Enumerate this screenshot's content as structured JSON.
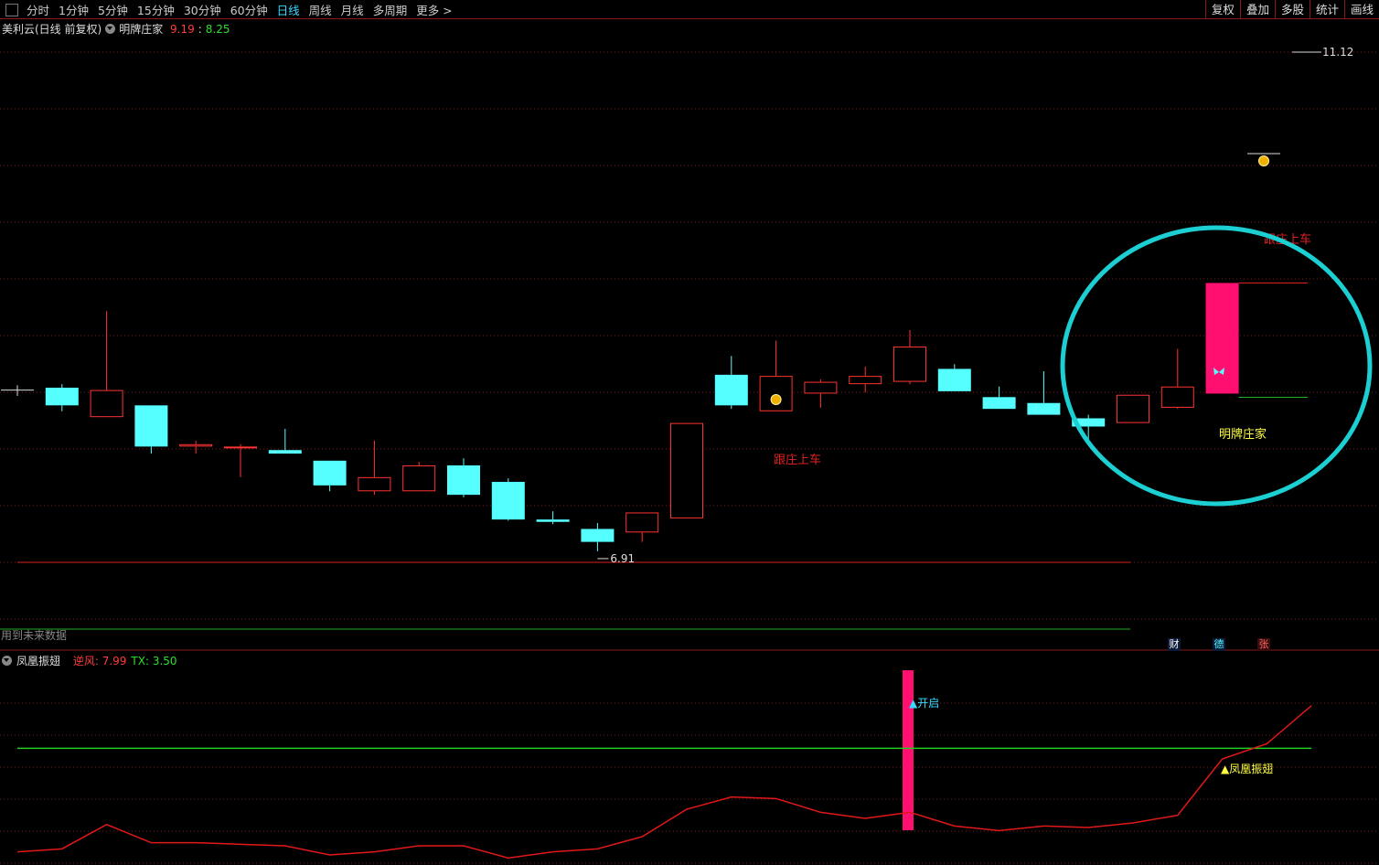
{
  "toolbar": {
    "periods": [
      "分时",
      "1分钟",
      "5分钟",
      "15分钟",
      "30分钟",
      "60分钟",
      "日线",
      "周线",
      "月线",
      "多周期",
      "更多 >"
    ],
    "active_period": "日线",
    "right_buttons": [
      "复权",
      "叠加",
      "多股",
      "统计",
      "画线"
    ]
  },
  "main_header": {
    "stock": "美利云(日线 前复权)",
    "indicator": "明牌庄家",
    "value1": "9.19",
    "value2": "8.25"
  },
  "main_labels": {
    "max_price": "11.12",
    "min_price": "6.91",
    "signal_text_1": "跟庄上车",
    "signal_text_2": "跟庄上车",
    "banker_text": "明牌庄家",
    "future_notice": "用到未来数据"
  },
  "badges": [
    "财",
    "德",
    "张"
  ],
  "sub_header": {
    "indicator": "凤凰振翅",
    "line1_label": "逆风: 7.99",
    "line2_label": "TX: 3.50"
  },
  "sub_labels": {
    "open_signal": "▲开启",
    "phoenix_signal": "▲凤凰振翅"
  },
  "colors": {
    "up": "#ff3333",
    "down": "#55ffff",
    "highlight_bar": "#ff0f70",
    "circle": "#1ccfd3",
    "threshold": "#20d020"
  },
  "chart_data": [
    {
      "type": "candlestick",
      "candles": [
        {
          "o": 8.28,
          "h": 8.32,
          "l": 8.23,
          "c": 8.28
        },
        {
          "o": 8.3,
          "h": 8.33,
          "l": 8.1,
          "c": 8.15
        },
        {
          "o": 8.05,
          "h": 8.95,
          "l": 8.05,
          "c": 8.28
        },
        {
          "o": 8.15,
          "h": 8.15,
          "l": 7.74,
          "c": 7.8
        },
        {
          "o": 7.8,
          "h": 7.85,
          "l": 7.74,
          "c": 7.82
        },
        {
          "o": 7.8,
          "h": 7.82,
          "l": 7.54,
          "c": 7.8
        },
        {
          "o": 7.77,
          "h": 7.95,
          "l": 7.74,
          "c": 7.74
        },
        {
          "o": 7.68,
          "h": 7.68,
          "l": 7.42,
          "c": 7.47
        },
        {
          "o": 7.42,
          "h": 7.85,
          "l": 7.39,
          "c": 7.54
        },
        {
          "o": 7.42,
          "h": 7.67,
          "l": 7.42,
          "c": 7.64
        },
        {
          "o": 7.64,
          "h": 7.7,
          "l": 7.37,
          "c": 7.39
        },
        {
          "o": 7.5,
          "h": 7.53,
          "l": 7.17,
          "c": 7.18
        },
        {
          "o": 7.18,
          "h": 7.25,
          "l": 7.14,
          "c": 7.16
        },
        {
          "o": 7.1,
          "h": 7.15,
          "l": 6.91,
          "c": 6.99
        },
        {
          "o": 7.07,
          "h": 7.24,
          "l": 6.99,
          "c": 7.24
        },
        {
          "o": 7.19,
          "h": 8.0,
          "l": 7.19,
          "c": 8.0
        },
        {
          "o": 8.41,
          "h": 8.57,
          "l": 8.12,
          "c": 8.15
        },
        {
          "o": 8.1,
          "h": 8.7,
          "l": 8.1,
          "c": 8.4
        },
        {
          "o": 8.25,
          "h": 8.37,
          "l": 8.13,
          "c": 8.35
        },
        {
          "o": 8.33,
          "h": 8.48,
          "l": 8.26,
          "c": 8.4
        },
        {
          "o": 8.35,
          "h": 8.79,
          "l": 8.33,
          "c": 8.65
        },
        {
          "o": 8.46,
          "h": 8.5,
          "l": 8.27,
          "c": 8.27
        },
        {
          "o": 8.22,
          "h": 8.31,
          "l": 8.12,
          "c": 8.12
        },
        {
          "o": 8.17,
          "h": 8.44,
          "l": 8.07,
          "c": 8.07
        },
        {
          "o": 8.04,
          "h": 8.07,
          "l": 7.86,
          "c": 7.97
        },
        {
          "o": 8.0,
          "h": 8.24,
          "l": 8.0,
          "c": 8.24
        },
        {
          "o": 8.13,
          "h": 8.63,
          "l": 8.12,
          "c": 8.31
        },
        {
          "o": 8.25,
          "h": 9.19,
          "l": 8.25,
          "c": 9.19
        }
      ],
      "y_range": [
        6.35,
        11.4
      ]
    },
    {
      "type": "line",
      "series": [
        {
          "name": "逆风",
          "values": [
            0.1,
            0.2,
            1.0,
            0.4,
            0.4,
            0.35,
            0.3,
            0.0,
            0.1,
            0.3,
            0.3,
            -0.1,
            0.1,
            0.2,
            0.6,
            1.5,
            1.9,
            1.85,
            1.4,
            1.2,
            1.4,
            0.95,
            0.8,
            0.95,
            0.9,
            1.05,
            1.3,
            3.15,
            3.65,
            4.9
          ]
        },
        {
          "name": "TX",
          "values": [
            3.5,
            3.5,
            3.5,
            3.5,
            3.5,
            3.5,
            3.5,
            3.5,
            3.5,
            3.5,
            3.5,
            3.5,
            3.5,
            3.5,
            3.5,
            3.5,
            3.5,
            3.5,
            3.5,
            3.5,
            3.5,
            3.5,
            3.5,
            3.5,
            3.5,
            3.5,
            3.5,
            3.5,
            3.5,
            3.5
          ]
        }
      ],
      "y_range": [
        -0.3,
        6.0
      ]
    }
  ]
}
